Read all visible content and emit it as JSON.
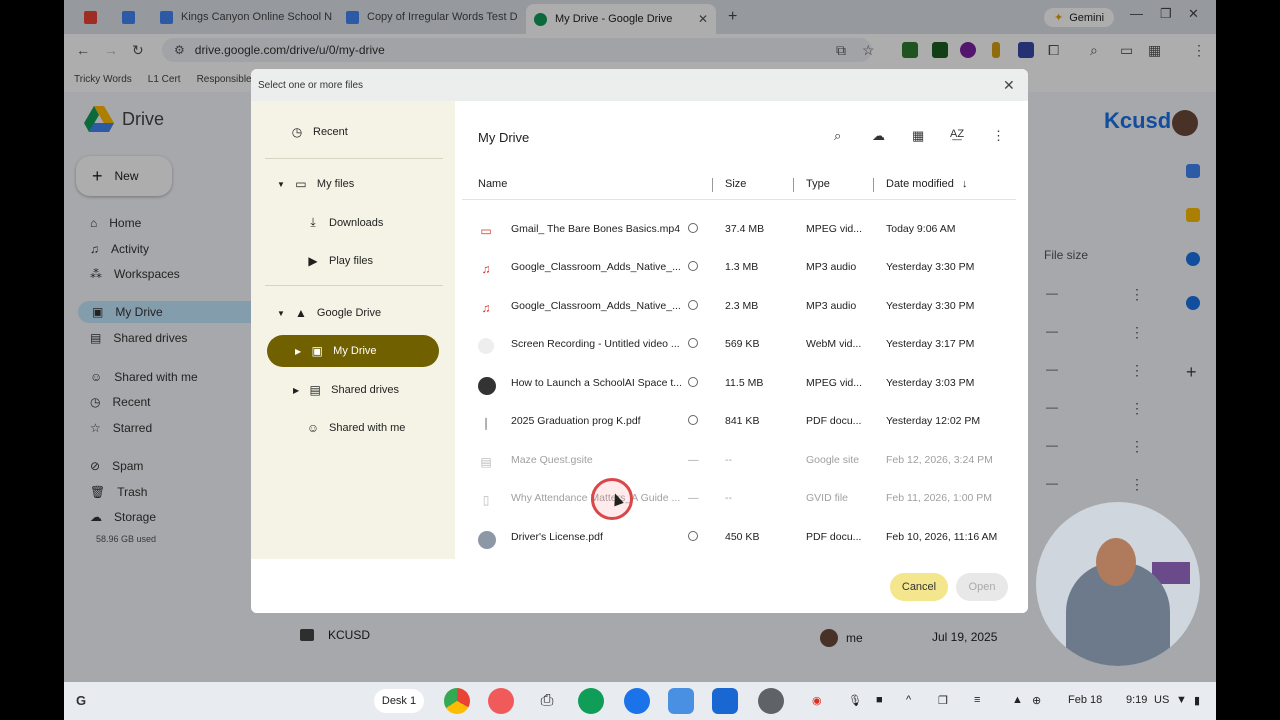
{
  "browser": {
    "tabs": [
      {
        "title": "",
        "icon": "gmail-icon",
        "color": "#ea4335"
      },
      {
        "title": "",
        "icon": "docs-icon",
        "color": "#4285f4"
      },
      {
        "title": "Kings Canyon Online School N",
        "icon": "docs-icon",
        "color": "#4285f4"
      },
      {
        "title": "Copy of Irregular Words Test D",
        "icon": "docs-icon",
        "color": "#4285f4"
      },
      {
        "title": "My Drive - Google Drive",
        "icon": "drive-icon",
        "color": "#0f9d58"
      }
    ],
    "gemini_label": "Gemini",
    "url": "drive.google.com/drive/u/0/my-drive",
    "bookmarks": [
      "Tricky Words",
      "L1 Cert",
      "Responsible A"
    ]
  },
  "drive": {
    "logo_text": "Drive",
    "new_label": "New",
    "nav": [
      "Home",
      "Activity",
      "Workspaces",
      "My Drive",
      "Shared drives",
      "Shared with me",
      "Recent",
      "Starred",
      "Spam",
      "Trash",
      "Storage"
    ],
    "storage_used": "58.96 GB used",
    "org_logo": "Kcusd",
    "col_file_size": "File size",
    "row_name": "KCUSD",
    "row_owner": "me",
    "row_date": "Jul 19, 2025"
  },
  "dialog": {
    "title": "Select one or more files",
    "left_nav": {
      "recent": "Recent",
      "my_files": "My files",
      "downloads": "Downloads",
      "play_files": "Play files",
      "google_drive": "Google Drive",
      "my_drive": "My Drive",
      "shared_drives": "Shared drives",
      "shared_with_me": "Shared with me"
    },
    "main_title": "My Drive",
    "columns": {
      "name": "Name",
      "size": "Size",
      "type": "Type",
      "date": "Date modified"
    },
    "files": [
      {
        "name": "Gmail_ The Bare Bones Basics.mp4",
        "size": "37.4 MB",
        "type": "MPEG vid...",
        "date": "Today 9:06 AM",
        "icon": "video-icon",
        "dim": false
      },
      {
        "name": "Google_Classroom_Adds_Native_...",
        "size": "1.3 MB",
        "type": "MP3 audio",
        "date": "Yesterday 3:30 PM",
        "icon": "audio-icon",
        "dim": false
      },
      {
        "name": "Google_Classroom_Adds_Native_...",
        "size": "2.3 MB",
        "type": "MP3 audio",
        "date": "Yesterday 3:30 PM",
        "icon": "audio-icon",
        "dim": false
      },
      {
        "name": "Screen Recording - Untitled video ...",
        "size": "569 KB",
        "type": "WebM vid...",
        "date": "Yesterday 3:17 PM",
        "icon": "video-thumb-icon",
        "dim": false
      },
      {
        "name": "How to Launch a SchoolAI Space t...",
        "size": "11.5 MB",
        "type": "MPEG vid...",
        "date": "Yesterday 3:03 PM",
        "icon": "video-thumb-icon",
        "dim": false
      },
      {
        "name": "2025 Graduation prog K.pdf",
        "size": "841 KB",
        "type": "PDF docu...",
        "date": "Yesterday 12:02 PM",
        "icon": "pdf-icon",
        "dim": false
      },
      {
        "name": "Maze Quest.gsite",
        "size": "--",
        "type": "Google site",
        "date": "Feb 12, 2026, 3:24 PM",
        "icon": "site-icon",
        "dim": true
      },
      {
        "name": "Why Attendance Matters_A Guide ...",
        "size": "--",
        "type": "GVID file",
        "date": "Feb 11, 2026, 1:00 PM",
        "icon": "file-icon",
        "dim": true
      },
      {
        "name": "Driver's License.pdf",
        "size": "450 KB",
        "type": "PDF docu...",
        "date": "Feb 10, 2026, 11:16 AM",
        "icon": "pdf-thumb-icon",
        "dim": false
      }
    ],
    "cancel_label": "Cancel",
    "open_label": "Open"
  },
  "shelf": {
    "desk_label": "Desk 1",
    "date": "Feb 18",
    "time": "9:19",
    "locale": "US"
  }
}
